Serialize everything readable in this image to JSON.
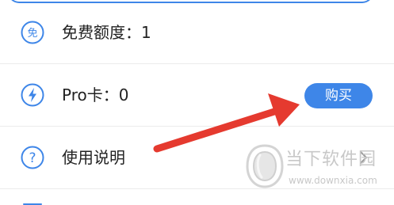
{
  "colors": {
    "accent": "#3e86e8",
    "arrow": "#e53a2f",
    "divider": "#ececec",
    "text": "#222222",
    "watermark": "#c8c8c8"
  },
  "menu": {
    "items": [
      {
        "icon": "free-badge-icon",
        "icon_text": "免",
        "label": "免费额度：1"
      },
      {
        "icon": "lightning-icon",
        "label": "Pro卡：0",
        "action_label": "购买"
      },
      {
        "icon": "question-icon",
        "icon_text": "?",
        "label": "使用说明",
        "trailing_icon": "chevron-right-icon"
      }
    ]
  },
  "watermark": {
    "icon": "downxia-logo-icon",
    "title": "当下软件园",
    "url": "www.downxia.com"
  }
}
